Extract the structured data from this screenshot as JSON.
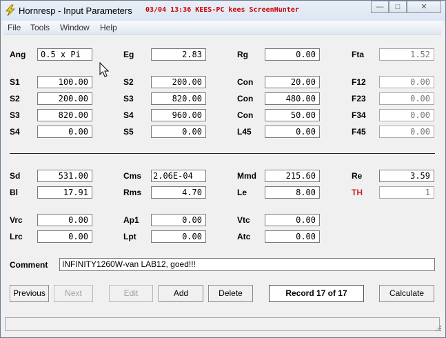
{
  "window": {
    "title": "Hornresp - Input Parameters",
    "screenhunter_text": "03/04 13:36 KEES-PC kees ScreenHunter",
    "controls": {
      "minimize": "—",
      "maximize": "□",
      "close": "✕"
    }
  },
  "menu": {
    "file": "File",
    "tools": "Tools",
    "window": "Window",
    "help": "Help"
  },
  "params": {
    "ang": {
      "label": "Ang",
      "value": "0.5 x Pi"
    },
    "eg": {
      "label": "Eg",
      "value": "2.83"
    },
    "rg": {
      "label": "Rg",
      "value": "0.00"
    },
    "fta": {
      "label": "Fta",
      "value": "1.52"
    },
    "s1": {
      "label": "S1",
      "value": "100.00"
    },
    "s2a": {
      "label": "S2",
      "value": "200.00"
    },
    "con1": {
      "label": "Con",
      "value": "20.00"
    },
    "f12": {
      "label": "F12",
      "value": "0.00"
    },
    "s2b": {
      "label": "S2",
      "value": "200.00"
    },
    "s3a": {
      "label": "S3",
      "value": "820.00"
    },
    "con2": {
      "label": "Con",
      "value": "480.00"
    },
    "f23": {
      "label": "F23",
      "value": "0.00"
    },
    "s3b": {
      "label": "S3",
      "value": "820.00"
    },
    "s4a": {
      "label": "S4",
      "value": "960.00"
    },
    "con3": {
      "label": "Con",
      "value": "50.00"
    },
    "f34": {
      "label": "F34",
      "value": "0.00"
    },
    "s4b": {
      "label": "S4",
      "value": "0.00"
    },
    "s5": {
      "label": "S5",
      "value": "0.00"
    },
    "l45": {
      "label": "L45",
      "value": "0.00"
    },
    "f45": {
      "label": "F45",
      "value": "0.00"
    },
    "sd": {
      "label": "Sd",
      "value": "531.00"
    },
    "cms": {
      "label": "Cms",
      "value": "2.06E-04"
    },
    "mmd": {
      "label": "Mmd",
      "value": "215.60"
    },
    "re": {
      "label": "Re",
      "value": "3.59"
    },
    "bl": {
      "label": "Bl",
      "value": "17.91"
    },
    "rms": {
      "label": "Rms",
      "value": "4.70"
    },
    "le": {
      "label": "Le",
      "value": "8.00"
    },
    "th": {
      "label": "TH",
      "value": "1"
    },
    "vrc": {
      "label": "Vrc",
      "value": "0.00"
    },
    "ap1": {
      "label": "Ap1",
      "value": "0.00"
    },
    "vtc": {
      "label": "Vtc",
      "value": "0.00"
    },
    "lrc": {
      "label": "Lrc",
      "value": "0.00"
    },
    "lpt": {
      "label": "Lpt",
      "value": "0.00"
    },
    "atc": {
      "label": "Atc",
      "value": "0.00"
    }
  },
  "comment": {
    "label": "Comment",
    "value": "INFINITY1260W-van LAB12, goed!!!"
  },
  "buttons": {
    "previous": "Previous",
    "next": "Next",
    "edit": "Edit",
    "add": "Add",
    "delete": "Delete",
    "calculate": "Calculate"
  },
  "record": "Record 17 of 17",
  "colors": {
    "accent_red": "#cc2222",
    "title_bg": "#dce6f2"
  }
}
